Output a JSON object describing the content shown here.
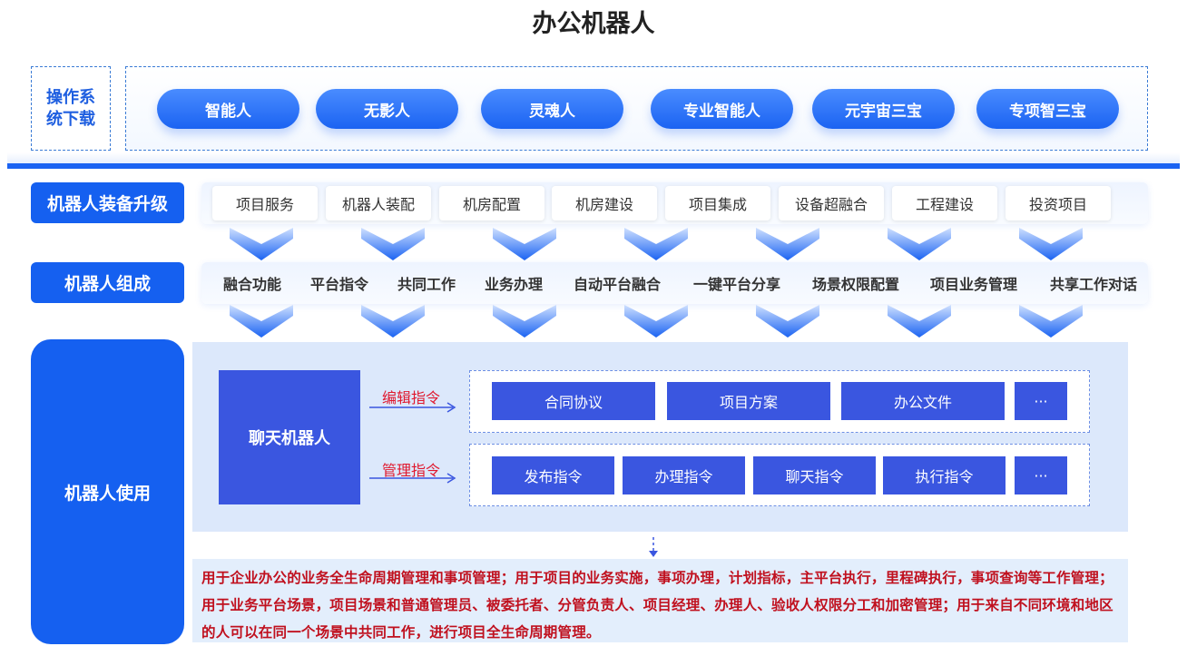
{
  "title": "办公机器人",
  "os_section": {
    "label": "操作系统下载",
    "items": [
      "智能人",
      "无影人",
      "灵魂人",
      "专业智能人",
      "元宇宙三宝",
      "专项智三宝"
    ]
  },
  "equipment": {
    "label": "机器人装备升级",
    "items": [
      "项目服务",
      "机器人装配",
      "机房配置",
      "机房建设",
      "项目集成",
      "设备超融合",
      "工程建设",
      "投资项目"
    ]
  },
  "composition": {
    "label": "机器人组成",
    "items": [
      "融合功能",
      "平台指令",
      "共同工作",
      "业务办理",
      "自动平台融合",
      "一键平台分享",
      "场景权限配置",
      "项目业务管理",
      "共享工作对话"
    ]
  },
  "usage": {
    "label": "机器人使用",
    "chat_bot": "聊天机器人",
    "edit_command": {
      "label": "编辑指令",
      "items": [
        "合同协议",
        "项目方案",
        "办公文件",
        "···"
      ]
    },
    "manage_command": {
      "label": "管理指令",
      "items": [
        "发布指令",
        "办理指令",
        "聊天指令",
        "执行指令",
        "···"
      ]
    },
    "description": "用于企业办公的业务全生命周期管理和事项管理；用于项目的业务实施，事项办理，计划指标，主平台执行，里程碑执行，事项查询等工作管理；用于业务平台场景，项目场景和普通管理员、被委托者、分管负责人、项目经理、办理人、验收人权限分工和加密管理；用于来自不同环境和地区的人可以在同一个场景中共同工作，进行项目全生命周期管理。"
  },
  "colors": {
    "primary": "#1560f0",
    "block": "#3a56e0",
    "accent_red": "#e0182e"
  }
}
